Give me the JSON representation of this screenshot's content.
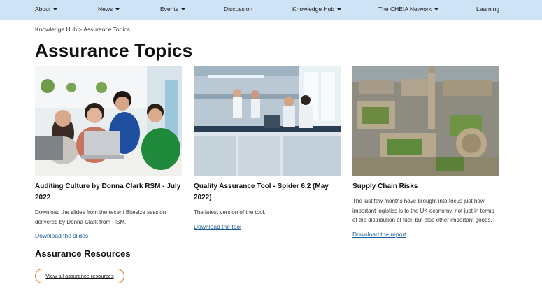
{
  "nav": {
    "items": [
      {
        "label": "About",
        "has_dropdown": true
      },
      {
        "label": "News",
        "has_dropdown": true
      },
      {
        "label": "Events",
        "has_dropdown": true
      },
      {
        "label": "Discussion",
        "has_dropdown": false
      },
      {
        "label": "Knowledge Hub",
        "has_dropdown": true
      },
      {
        "label": "The CHEIA Network",
        "has_dropdown": true
      },
      {
        "label": "Learning",
        "has_dropdown": false
      }
    ],
    "background": "#cfe3f7"
  },
  "breadcrumb": {
    "parent": "Knowledge Hub",
    "separator": ">",
    "current": "Assurance Topics"
  },
  "page_title": "Assurance Topics",
  "cards": [
    {
      "image": "people-at-laptop-photo",
      "title": "Auditing Culture by Donna Clark RSM - July 2022",
      "description": "Download the slides from the recent Bitesize session delivered by Donna Clark from RSM.",
      "link": "Download the slides"
    },
    {
      "image": "laboratory-photo",
      "title": "Quality Assurance Tool - Spider 6.2 (May 2022)",
      "description": "The latest version of the tool.",
      "link": "Download the tool"
    },
    {
      "image": "aerial-city-photo",
      "title": "Supply Chain Risks",
      "description": "The last few months have brought into focus just how important logistics is to the UK economy, not just in terms of the distribution of fuel, but also other important goods.",
      "link": "Download the report"
    }
  ],
  "resources": {
    "title": "Assurance Resources",
    "button_label": "View all assurance resources"
  },
  "colors": {
    "link": "#1c5d99",
    "button_border": "#e0702a"
  }
}
